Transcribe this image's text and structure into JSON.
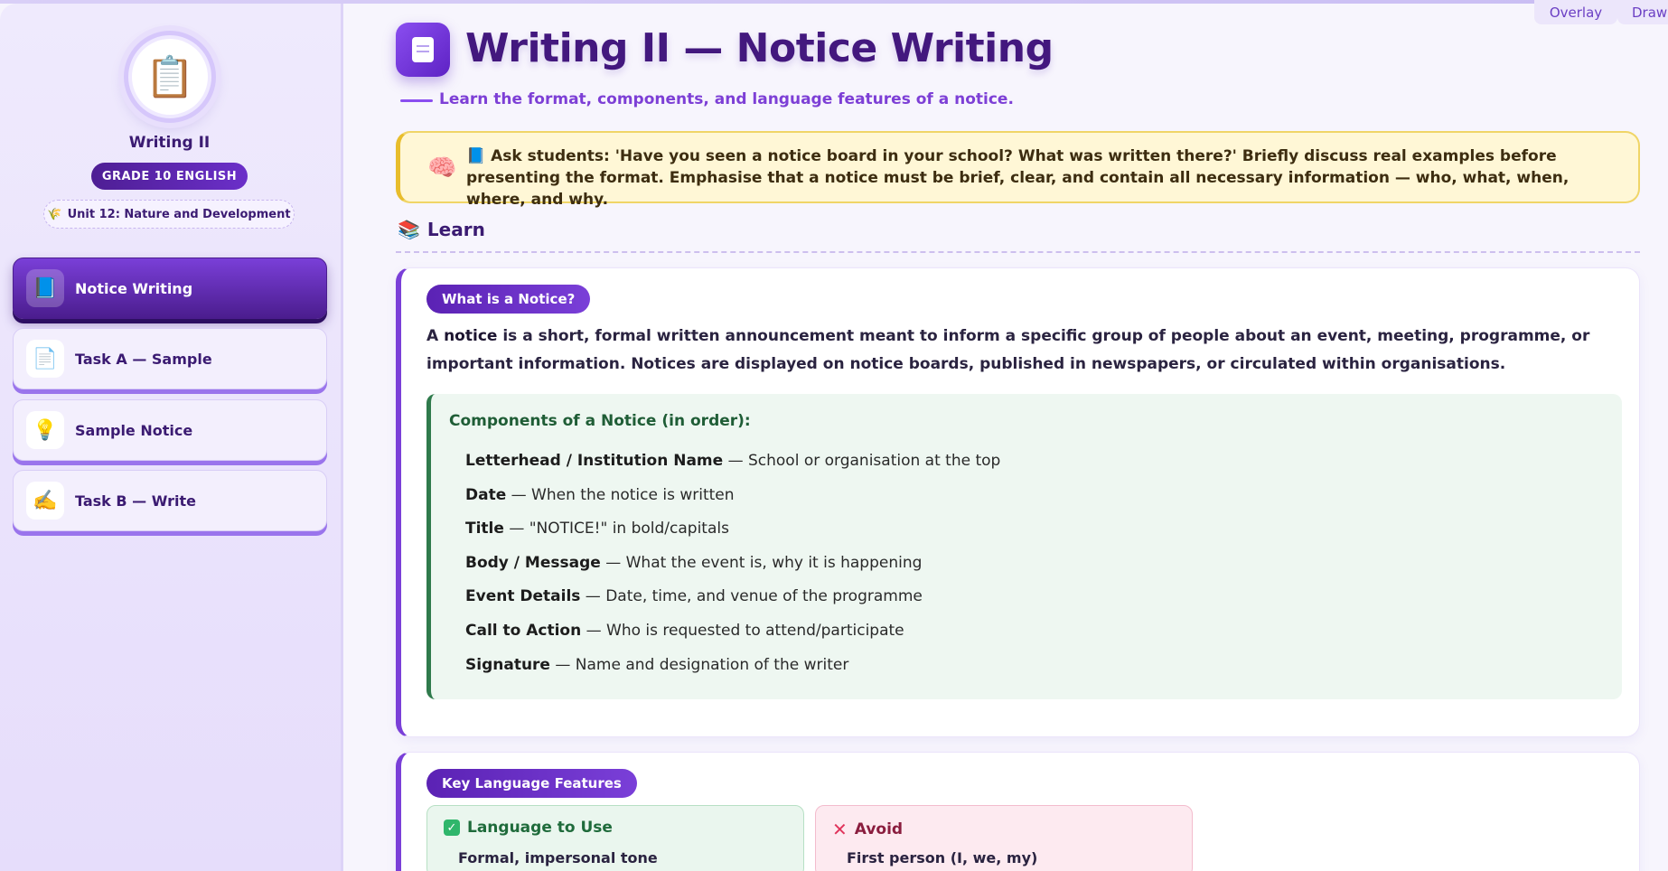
{
  "toolbar": {
    "overlay_label": "Overlay",
    "draw_label": "Draw"
  },
  "sidebar": {
    "avatar_emoji": "📋",
    "title": "Writing II",
    "grade_badge": "GRADE 10 ENGLISH",
    "unit_icon": "🌾",
    "unit": "Unit 12: Nature and Development",
    "items": [
      {
        "icon": "📘",
        "label": "Notice Writing",
        "active": true
      },
      {
        "icon": "📄",
        "label": "Task A — Sample",
        "active": false
      },
      {
        "icon": "💡",
        "label": "Sample Notice",
        "active": false
      },
      {
        "icon": "✍️",
        "label": "Task B — Write",
        "active": false
      }
    ]
  },
  "header": {
    "title": "Writing II — Notice Writing",
    "subtitle": "Learn the format, components, and language features of a notice."
  },
  "tip": {
    "icon": "🧠",
    "book_icon": "📘",
    "text": "Ask students: 'Have you seen a notice board in your school? What was written there?' Briefly discuss real examples before presenting the format. Emphasise that a notice must be brief, clear, and contain all necessary information — who, what, when, where, and why."
  },
  "section": {
    "icon": "📚",
    "title": "Learn"
  },
  "what_card": {
    "pill": "What is a Notice?",
    "para_a": "A ",
    "para_bold": "notice",
    "para_b": " is a short, formal written announcement meant to inform a specific group of people about an event, meeting, programme, or important information. Notices are displayed on notice boards, published in newspapers, or circulated within organisations.",
    "components_title": "Components of a Notice (in order):",
    "components": [
      {
        "key": "Letterhead / Institution Name",
        "desc": " — School or organisation at the top"
      },
      {
        "key": "Date",
        "desc": " — When the notice is written"
      },
      {
        "key": "Title",
        "desc": " — \"NOTICE!\" in bold/capitals"
      },
      {
        "key": "Body / Message",
        "desc": " — What the event is, why it is happening"
      },
      {
        "key": "Event Details",
        "desc": " — Date, time, and venue of the programme"
      },
      {
        "key": "Call to Action",
        "desc": " — Who is requested to attend/participate"
      },
      {
        "key": "Signature",
        "desc": " — Name and designation of the writer"
      }
    ]
  },
  "lang_card": {
    "pill": "Key Language Features",
    "use_head": "Language to Use",
    "use_item": "Formal, impersonal tone",
    "avoid_head": "Avoid",
    "avoid_item": "First person (I, we, my)"
  }
}
